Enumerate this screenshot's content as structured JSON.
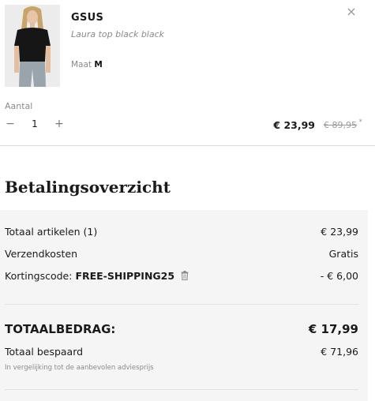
{
  "product": {
    "brand": "GSUS",
    "name": "Laura top black black",
    "size_label": "Maat",
    "size_value": "M",
    "close_icon": "×",
    "quantity_label": "Aantal",
    "quantity_value": "1",
    "minus_icon": "−",
    "plus_icon": "+",
    "price": "€ 23,99",
    "old_price": "€ 89,95",
    "price_note": "*"
  },
  "overview": {
    "title": "Betalingsoverzicht",
    "items_label": "Totaal artikelen (1)",
    "items_value": "€ 23,99",
    "shipping_label": "Verzendkosten",
    "shipping_value": "Gratis",
    "discount_label": "Kortingscode: ",
    "discount_code": "FREE-SHIPPING25",
    "discount_value": "- € 6,00",
    "total_label": "TOTAALBEDRAG:",
    "total_value": "€ 17,99",
    "saved_label": "Totaal bespaard",
    "saved_value": "€ 71,96",
    "note": "In vergelijking tot de aanbevolen adviesprijs"
  },
  "colors": {
    "panel": "#f5f5f5",
    "muted": "#8a8a8a"
  },
  "icons": {
    "close": "close-icon",
    "trash": "trash-icon"
  }
}
